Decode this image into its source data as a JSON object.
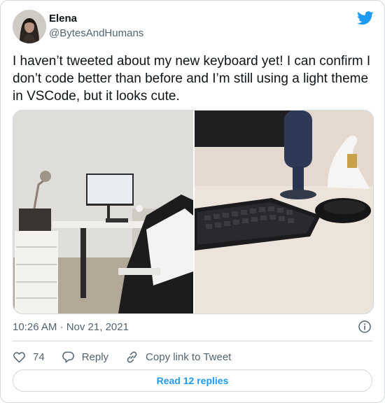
{
  "author": {
    "name": "Elena",
    "handle": "@BytesAndHumans"
  },
  "tweet": {
    "text": "I haven’t tweeted about my new keyboard yet! I can confirm I don’t code better than before and I’m still using a light theme in VSCode, but it looks cute.",
    "timestamp": "10:26 AM · Nov 21, 2021"
  },
  "media": [
    {
      "icon": "photo-desk-setup"
    },
    {
      "icon": "photo-keyboard-closeup"
    }
  ],
  "actions": {
    "like_count": "74",
    "reply_label": "Reply",
    "copy_label": "Copy link to Tweet"
  },
  "read_replies_label": "Read 12 replies",
  "colors": {
    "accent": "#1d9bf0",
    "text": "#0f1419",
    "muted": "#536471",
    "border": "#cfd9de"
  }
}
